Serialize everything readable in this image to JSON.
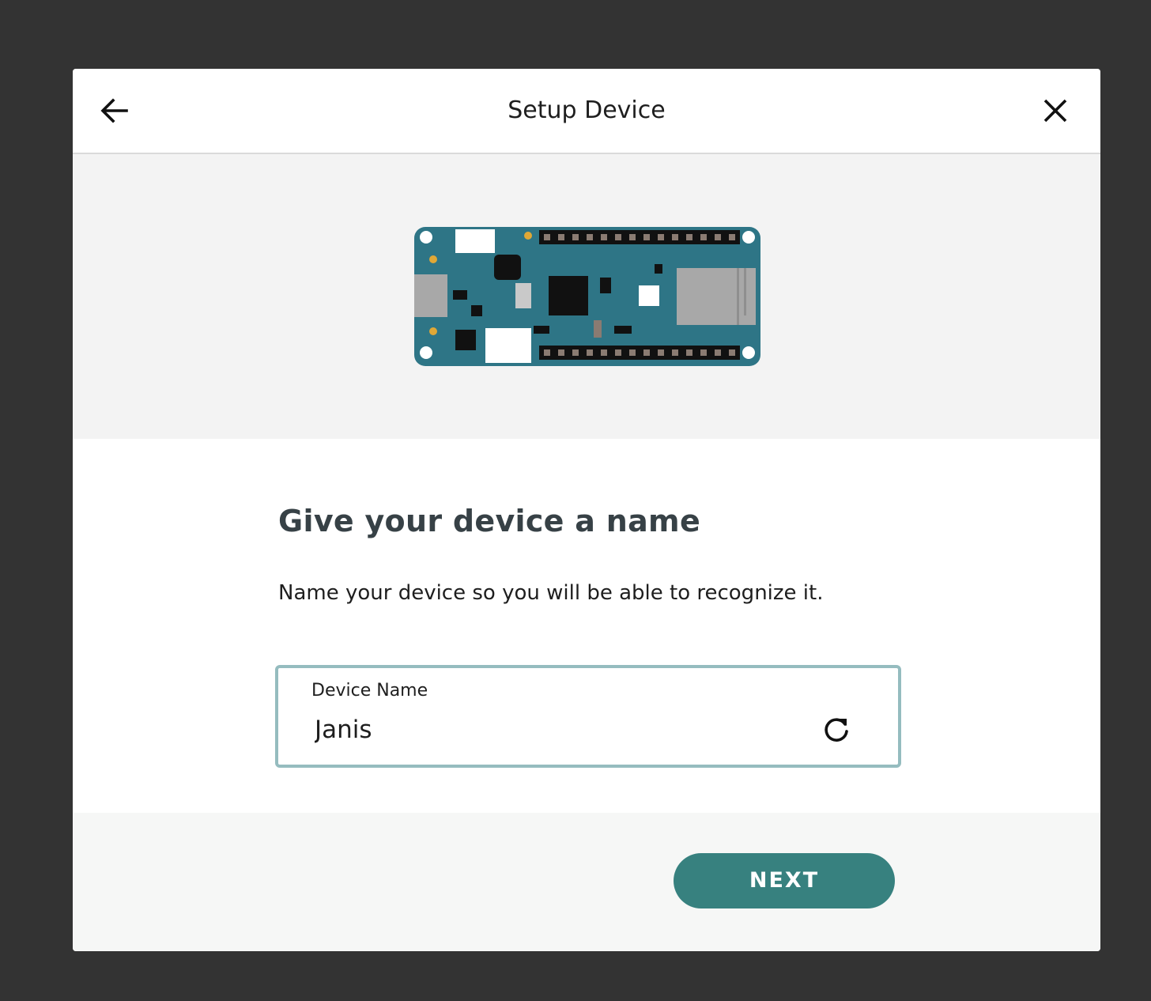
{
  "header": {
    "title": "Setup Device",
    "back_icon": "arrow-left-icon",
    "close_icon": "close-icon"
  },
  "illustration": {
    "board_color": "#2e7586",
    "icon": "arduino-board-illustration"
  },
  "content": {
    "heading": "Give your device a name",
    "description": "Name your device so you will be able to recognize it."
  },
  "device_name_field": {
    "label": "Device Name",
    "value": "Janis",
    "refresh_icon": "refresh-icon"
  },
  "footer": {
    "next_label": "NEXT"
  },
  "colors": {
    "accent": "#37817f",
    "field_border": "#95bcbf",
    "heading": "#374146",
    "backdrop": "#333333"
  }
}
